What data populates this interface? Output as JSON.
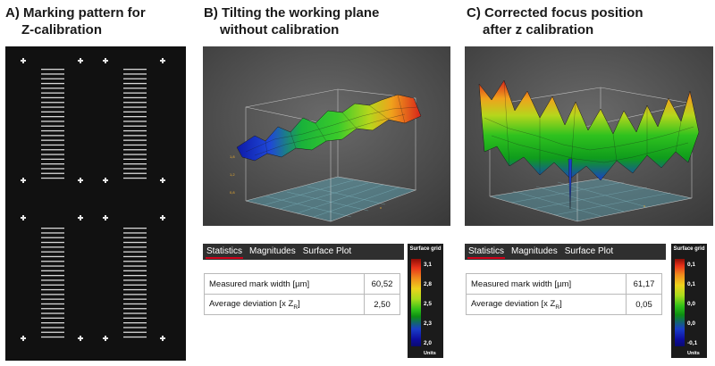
{
  "panel_a": {
    "title_line1": "A) Marking pattern for",
    "title_line2": "Z-calibration"
  },
  "panel_b": {
    "title_line1": "B)  Tilting the working plane",
    "title_line2": "without calibration",
    "tabs": [
      {
        "label": "Statistics",
        "active": true
      },
      {
        "label": "Magnitudes",
        "active": false
      },
      {
        "label": "Surface Plot",
        "active": false
      }
    ],
    "stats": {
      "mark_width_label": "Measured mark width [µm]",
      "mark_width_value": "60,52",
      "deviation_label_prefix": "Average deviation [x Z",
      "deviation_label_sub": "R",
      "deviation_label_suffix": "]",
      "deviation_value": "2,50"
    },
    "legend": {
      "title": "Surface grid",
      "units": "Units",
      "ticks": [
        "3,1",
        "2,8",
        "2,5",
        "2,3",
        "2,0"
      ]
    }
  },
  "panel_c": {
    "title_line1": "C)  Corrected focus position",
    "title_line2": "after z calibration",
    "tabs": [
      {
        "label": "Statistics",
        "active": true
      },
      {
        "label": "Magnitudes",
        "active": false
      },
      {
        "label": "Surface Plot",
        "active": false
      }
    ],
    "stats": {
      "mark_width_label": "Measured mark width [µm]",
      "mark_width_value": "61,17",
      "deviation_label_prefix": "Average deviation [x Z",
      "deviation_label_sub": "R",
      "deviation_label_suffix": "]",
      "deviation_value": "0,05"
    },
    "legend": {
      "title": "Surface grid",
      "units": "Units",
      "ticks": [
        "0,1",
        "0,1",
        "0,0",
        "0,0",
        "-0,1"
      ]
    }
  },
  "colors": {
    "accent": "#d0021b",
    "plot_background": "#4a4a4a",
    "tab_background": "#2f2f2f",
    "pattern_background": "#111111"
  }
}
